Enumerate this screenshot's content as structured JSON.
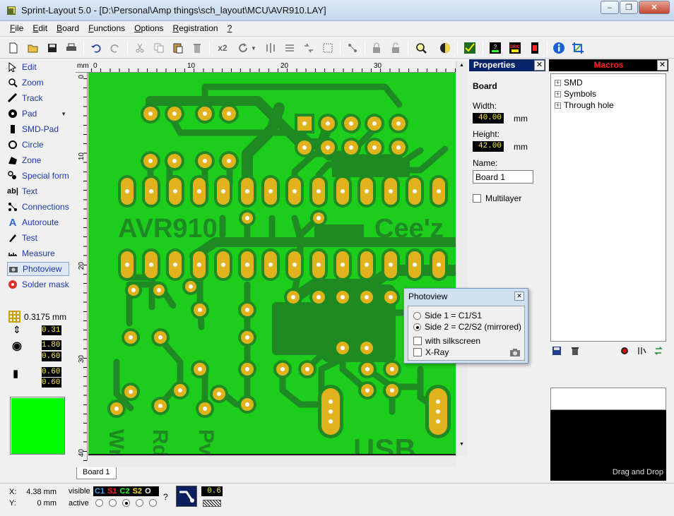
{
  "window": {
    "title": "Sprint-Layout 5.0 - [D:\\Personal\\Amp things\\sch_layout\\MCU\\AVR910.LAY]"
  },
  "menu": [
    {
      "label": "File",
      "u": "F",
      "rest": "ile"
    },
    {
      "label": "Edit",
      "u": "E",
      "rest": "dit"
    },
    {
      "label": "Board",
      "u": "B",
      "rest": "oard"
    },
    {
      "label": "Functions",
      "u": "F",
      "rest": "unctions"
    },
    {
      "label": "Options",
      "u": "O",
      "rest": "ptions"
    },
    {
      "label": "Registration",
      "u": "R",
      "rest": "egistration"
    },
    {
      "label": "?",
      "u": "?",
      "rest": ""
    }
  ],
  "toolbar": {
    "icons": [
      "new-icon",
      "open-icon",
      "save-icon",
      "print-icon",
      "undo-icon",
      "redo-icon",
      "cut-icon",
      "copy-icon",
      "paste-icon",
      "delete-icon",
      "x2-icon",
      "rotate-icon",
      "mirror-icon",
      "align-icon",
      "group-icon",
      "ungroup-icon",
      "connect-icon",
      "lock-icon",
      "unlock-icon",
      "zoom-icon",
      "mask-icon",
      "drc-check-icon",
      "components-icon",
      "drc-icon",
      "macro-icon",
      "info-icon",
      "crop-icon"
    ],
    "x2_label": "x2",
    "drc_label": "DRC"
  },
  "tools": [
    {
      "name": "edit",
      "label": "Edit",
      "icon": "cursor-icon"
    },
    {
      "name": "zoom",
      "label": "Zoom",
      "icon": "magnifier-icon"
    },
    {
      "name": "track",
      "label": "Track",
      "icon": "track-icon"
    },
    {
      "name": "pad",
      "label": "Pad",
      "icon": "pad-icon"
    },
    {
      "name": "smd-pad",
      "label": "SMD-Pad",
      "icon": "smd-pad-icon"
    },
    {
      "name": "circle",
      "label": "Circle",
      "icon": "circle-icon"
    },
    {
      "name": "zone",
      "label": "Zone",
      "icon": "zone-icon"
    },
    {
      "name": "special-form",
      "label": "Special form",
      "icon": "special-form-icon"
    },
    {
      "name": "text",
      "label": "Text",
      "icon": "text-icon"
    },
    {
      "name": "connections",
      "label": "Connections",
      "icon": "connections-icon"
    },
    {
      "name": "autoroute",
      "label": "Autoroute",
      "icon": "autoroute-icon"
    },
    {
      "name": "test",
      "label": "Test",
      "icon": "test-icon"
    },
    {
      "name": "measure",
      "label": "Measure",
      "icon": "measure-icon"
    },
    {
      "name": "photoview",
      "label": "Photoview",
      "icon": "camera-icon",
      "selected": true
    },
    {
      "name": "solder-mask",
      "label": "Solder mask",
      "icon": "solder-mask-icon"
    }
  ],
  "grid": {
    "value": "0.3175 mm"
  },
  "settings": {
    "track_width": "0.31",
    "pad_outer": "1.80",
    "pad_inner": "0.60",
    "smd_width": "0.60",
    "smd_height": "0.60"
  },
  "colors": {
    "active_layer": "#00ff00",
    "board": "#1ccd1c",
    "pad": "#e0b21c",
    "copper_dark": "#1f8a24"
  },
  "rulers": {
    "unit": "mm",
    "top_ticks": [
      "0",
      "10",
      "20",
      "30"
    ],
    "left_ticks": [
      "0",
      "10",
      "20",
      "30",
      "40"
    ]
  },
  "board": {
    "silkscreen_text": [
      "AVR910",
      "Cee'z",
      "USB"
    ],
    "vertical_text": [
      "Wr",
      "Rd",
      "Pv"
    ]
  },
  "board_tab": "Board 1",
  "properties": {
    "title": "Properties",
    "section": "Board",
    "width_label": "Width:",
    "width_value": "40.00",
    "height_label": "Height:",
    "height_value": "42.00",
    "unit": "mm",
    "name_label": "Name:",
    "name_value": "Board 1",
    "multilayer_label": "Multilayer"
  },
  "macros": {
    "title": "Macros",
    "items": [
      "SMD",
      "Symbols",
      "Through hole"
    ],
    "drag_label": "Drag and Drop"
  },
  "status": {
    "x_label": "X:",
    "x_value": "4.38 mm",
    "y_label": "Y:",
    "y_value": "0 mm",
    "visible_label": "visible",
    "active_label": "active",
    "layers": [
      {
        "label": "C1",
        "color": "#3da0ff"
      },
      {
        "label": "S1",
        "color": "#ff2020"
      },
      {
        "label": "C2",
        "color": "#20ff20"
      },
      {
        "label": "S2",
        "color": "#ffe020"
      },
      {
        "label": "O",
        "color": "#ffffff"
      }
    ],
    "help": "?",
    "zoom_value": "0.6"
  },
  "photoview": {
    "title": "Photoview",
    "side1_label": "Side 1 = C1/S1",
    "side2_label": "Side 2 = C2/S2 (mirrored)",
    "silkscreen_label": "with silkscreen",
    "xray_label": "X-Ray"
  }
}
